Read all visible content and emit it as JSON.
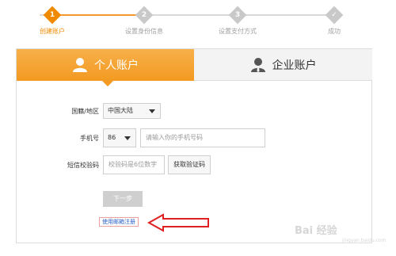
{
  "stepper": {
    "steps": [
      {
        "num": "1",
        "label": "创建账户"
      },
      {
        "num": "2",
        "label": "设置身份信息"
      },
      {
        "num": "3",
        "label": "设置支付方式"
      },
      {
        "num": "✓",
        "label": "成功"
      }
    ]
  },
  "tabs": {
    "personal": "个人账户",
    "enterprise": "企业账户"
  },
  "form": {
    "region_label": "国籍/地区",
    "region_value": "中国大陆",
    "phone_label": "手机号",
    "country_code": "86",
    "phone_placeholder": "请输入你的手机号码",
    "sms_label": "短信校验码",
    "sms_placeholder": "校验码是6位数字",
    "get_code_button": "获取验证码",
    "next_button": "下一步",
    "email_register_link": "使用邮箱注册"
  },
  "colors": {
    "accent": "#f29a22",
    "annotation": "#e02020"
  },
  "watermark": {
    "text": "Bai 经验",
    "sub": "jingyan.baidu.com"
  }
}
